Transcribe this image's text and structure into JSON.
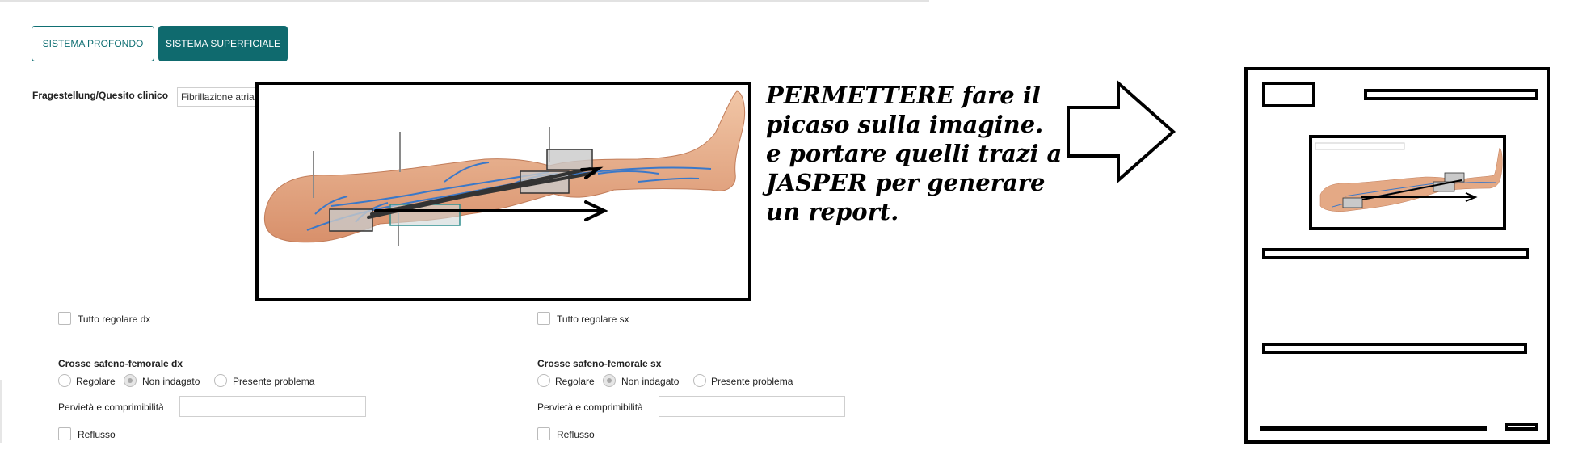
{
  "tabs": {
    "profondo": "SISTEMA PROFONDO",
    "superficiale": "SISTEMA SUPERFICIALE"
  },
  "quesito": {
    "label": "Fragestellung/Quesito clinico",
    "value": "Fibrillazione atriale"
  },
  "dx": {
    "tutto_regolare": "Tutto regolare dx",
    "crosse_title": "Crosse safeno-femorale dx",
    "radio_regolare": "Regolare",
    "radio_non_indagato": "Non indagato",
    "radio_presente": "Presente problema",
    "pervieta_label": "Pervietà e comprimibilità",
    "reflusso": "Reflusso"
  },
  "sx": {
    "tutto_regolare": "Tutto regolare sx",
    "crosse_title": "Crosse safeno-femorale sx",
    "radio_regolare": "Regolare",
    "radio_non_indagato": "Non indagato",
    "radio_presente": "Presente problema",
    "pervieta_label": "Pervietà e comprimibilità",
    "reflusso": "Reflusso"
  },
  "note": {
    "line1": "PERMETTERE fare il",
    "line2": "picaso sulla imagine.",
    "line3": "e portare quelli trazi a",
    "line4": "JASPER per generare",
    "line5": "un report."
  },
  "colors": {
    "accent": "#0f6a6e",
    "vein": "#3a78c9",
    "skin": "#e2a27c",
    "annotation": "#000000"
  },
  "icons": [
    "right-arrow-icon",
    "leg-veins-diagram"
  ]
}
